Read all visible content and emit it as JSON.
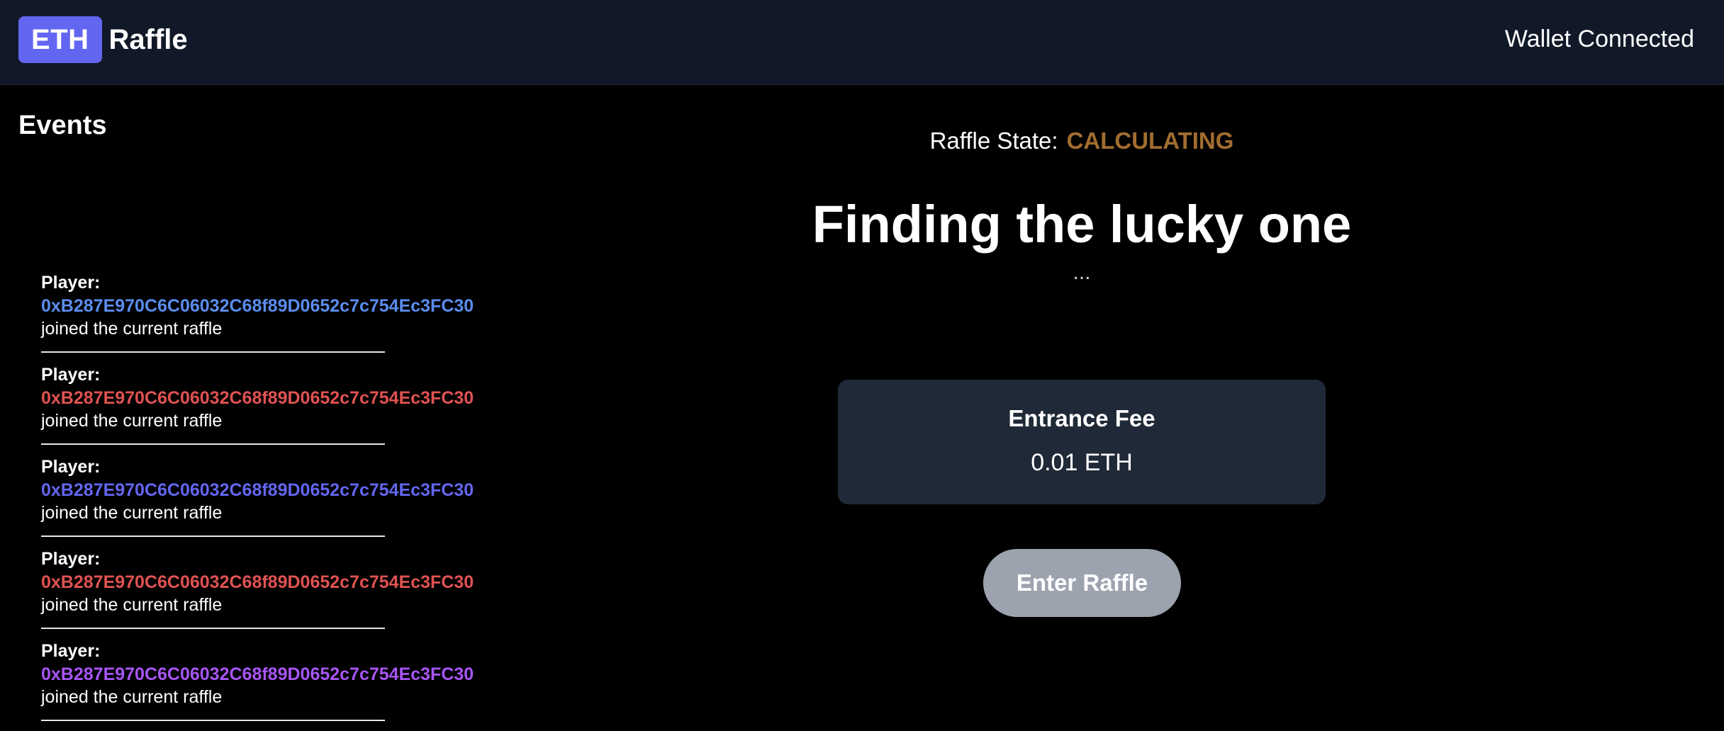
{
  "header": {
    "logo_badge": "ETH",
    "logo_text": "Raffle",
    "wallet_status": "Wallet Connected"
  },
  "events": {
    "title": "Events",
    "items": [
      {
        "label": "Player:",
        "address": "0xB287E970C6C06032C68f89D0652c7c754Ec3FC30",
        "address_color": "#5b8def",
        "text": "joined the current raffle"
      },
      {
        "label": "Player:",
        "address": "0xB287E970C6C06032C68f89D0652c7c754Ec3FC30",
        "address_color": "#e05252",
        "text": "joined the current raffle"
      },
      {
        "label": "Player:",
        "address": "0xB287E970C6C06032C68f89D0652c7c754Ec3FC30",
        "address_color": "#6366f1",
        "text": "joined the current raffle"
      },
      {
        "label": "Player:",
        "address": "0xB287E970C6C06032C68f89D0652c7c754Ec3FC30",
        "address_color": "#e05252",
        "text": "joined the current raffle"
      },
      {
        "label": "Player:",
        "address": "0xB287E970C6C06032C68f89D0652c7c754Ec3FC30",
        "address_color": "#a855f7",
        "text": "joined the current raffle"
      }
    ]
  },
  "main": {
    "state_label": "Raffle State:",
    "state_value": "CALCULATING",
    "headline": "Finding the lucky one",
    "ellipsis": "...",
    "fee_title": "Entrance Fee",
    "fee_value": "0.01 ETH",
    "enter_button": "Enter Raffle"
  },
  "colors": {
    "header_bg": "#111827",
    "accent": "#6366f1",
    "state_calculating": "#a16d2f",
    "card_bg": "#1f2937",
    "button_disabled": "#9ca3af"
  }
}
